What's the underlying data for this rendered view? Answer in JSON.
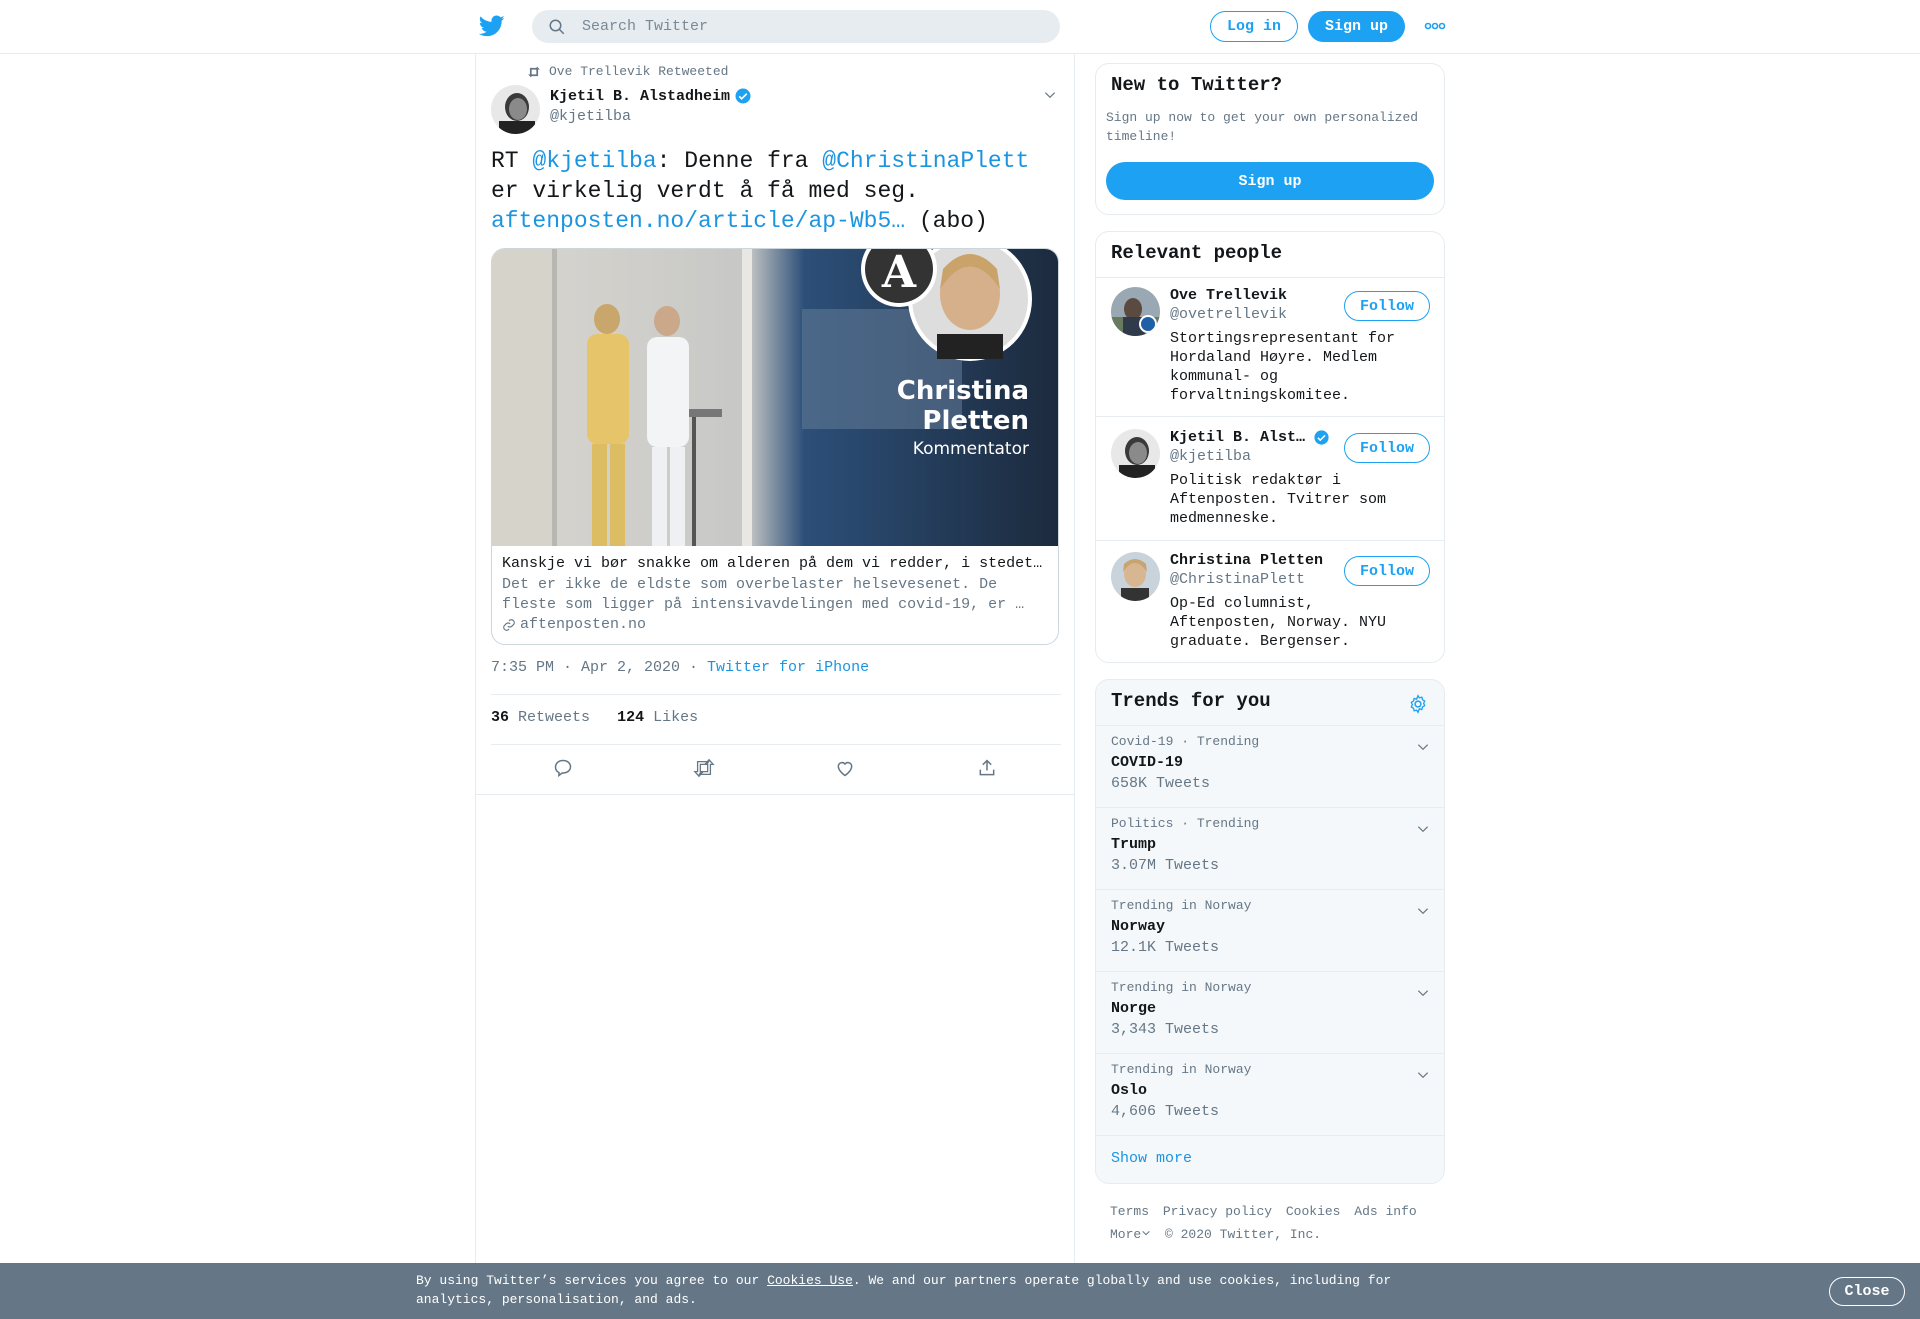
{
  "header": {
    "search_placeholder": "Search Twitter",
    "login_label": "Log in",
    "signup_label": "Sign up"
  },
  "tweet": {
    "retweeted_by": "Ove Trellevik Retweeted",
    "author_name": "Kjetil B. Alstadheim",
    "author_handle": "@kjetilba",
    "text_rt": "RT ",
    "mention1": "@kjetilba",
    "text_mid": ": Denne fra ",
    "mention2": "@ChristinaPlett",
    "text_line2": "er virkelig verdt å få med seg.",
    "link": "aftenposten.no/article/ap-Wb5…",
    "text_end": " (abo)",
    "card": {
      "image_title": "Christina Pletten",
      "image_title_line1": "Christina",
      "image_title_line2": "Pletten",
      "image_subtitle": "Kommentator",
      "logo_letter": "A",
      "title": "Kanskje vi bør snakke om alderen på dem vi redder, i stedet for alderen på dem vi ikke redder",
      "description": "Det er ikke de eldste som overbelaster helsevesenet. De fleste som ligger på intensivavdelingen med covid-19, er …",
      "domain": "aftenposten.no"
    },
    "time": "7:35 PM · Apr 2, 2020",
    "meta_sep": " · ",
    "source": "Twitter for iPhone",
    "retweets_count": "36",
    "retweets_label": "Retweets",
    "likes_count": "124",
    "likes_label": "Likes"
  },
  "new_to_twitter": {
    "title": "New to Twitter?",
    "text": "Sign up now to get your own personalized timeline!",
    "button": "Sign up"
  },
  "relevant_people": {
    "title": "Relevant people",
    "people": [
      {
        "name": "Ove Trellevik",
        "handle": "@ovetrellevik",
        "bio": "Stortingsrepresentant for Hordaland Høyre. Medlem kommunal- og forvaltningskomitee.",
        "follow": "Follow",
        "verified": false
      },
      {
        "name": "Kjetil B. Alstadheim",
        "handle": "@kjetilba",
        "bio": "Politisk redaktør i Aftenposten. Tvitrer som medmenneske.",
        "follow": "Follow",
        "verified": true
      },
      {
        "name": "Christina Pletten",
        "handle": "@ChristinaPlett",
        "bio": "Op-Ed columnist, Aftenposten, Norway. NYU graduate. Bergenser.",
        "follow": "Follow",
        "verified": false
      }
    ]
  },
  "trends": {
    "title": "Trends for you",
    "items": [
      {
        "context": "Covid-19 · Trending",
        "name": "COVID-19",
        "count": "658K Tweets"
      },
      {
        "context": "Politics · Trending",
        "name": "Trump",
        "count": "3.07M Tweets"
      },
      {
        "context": "Trending in Norway",
        "name": "Norway",
        "count": "12.1K Tweets"
      },
      {
        "context": "Trending in Norway",
        "name": "Norge",
        "count": "3,343 Tweets"
      },
      {
        "context": "Trending in Norway",
        "name": "Oslo",
        "count": "4,606 Tweets"
      }
    ],
    "show_more": "Show more"
  },
  "footer": {
    "terms": "Terms",
    "privacy": "Privacy policy",
    "cookies": "Cookies",
    "ads": "Ads info",
    "more": "More",
    "copyright": "© 2020 Twitter, Inc."
  },
  "cookie_bar": {
    "text_before": "By using Twitter’s services you agree to our ",
    "link": "Cookies Use",
    "text_after": ". We and our partners operate globally and use cookies, including for analytics, personalisation, and ads.",
    "close": "Close"
  },
  "colors": {
    "accent": "#1da1f2",
    "link": "#1b95e0",
    "secondary_text": "#657786",
    "cookie_bar": "#657786"
  },
  "icons": [
    "twitter-logo-icon",
    "search-icon",
    "more-dots-icon",
    "retweet-icon",
    "verified-badge-icon",
    "chevron-down-icon",
    "link-icon",
    "reply-icon",
    "like-icon",
    "share-icon",
    "settings-gear-icon"
  ]
}
